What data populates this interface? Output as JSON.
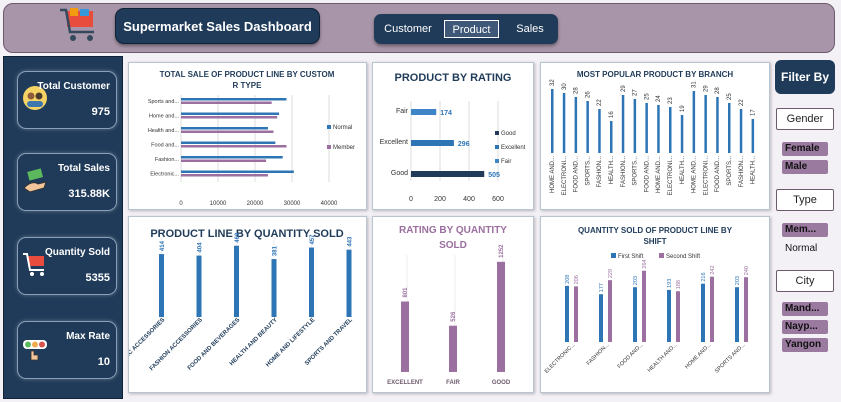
{
  "header": {
    "title": "Supermarket Sales Dashboard",
    "tabs": [
      {
        "label": "Customer",
        "active": false
      },
      {
        "label": "Product",
        "active": true
      },
      {
        "label": "Sales",
        "active": false
      }
    ]
  },
  "kpis": [
    {
      "label": "Total Customer",
      "value": "975",
      "icon": "customers-icon"
    },
    {
      "label": "Total Sales",
      "value": "315.88K",
      "icon": "money-hand-icon"
    },
    {
      "label": "Quantity Sold",
      "value": "5355",
      "icon": "cart-icon"
    },
    {
      "label": "Max Rate",
      "value": "10",
      "icon": "rating-icon"
    }
  ],
  "filters": {
    "title": "Filter By",
    "groups": [
      {
        "label": "Gender",
        "options": [
          "Female",
          "Male"
        ]
      },
      {
        "label": "Type",
        "options": [
          "Mem...",
          "Normal"
        ]
      },
      {
        "label": "City",
        "options": [
          "Mand...",
          "Nayp...",
          "Yangon"
        ]
      }
    ]
  },
  "colors": {
    "normal": "#2e75b6",
    "member": "#9b6fa0",
    "dark_blue": "#1f3b59",
    "header": "#a995a9"
  },
  "chart_data": [
    {
      "type": "bar",
      "orientation": "horizontal",
      "title": "TOTAL SALE OF PRODUCT LINE BY CUSTOMER TYPE",
      "categories": [
        "Sports and...",
        "Home and...",
        "Health and...",
        "Food and...",
        "Fashion...",
        "Electronic..."
      ],
      "series": [
        {
          "name": "Normal",
          "values": [
            28500,
            26500,
            23500,
            25500,
            27500,
            30500
          ]
        },
        {
          "name": "Member",
          "values": [
            24500,
            26000,
            25000,
            28500,
            23000,
            23500
          ]
        }
      ],
      "xticks": [
        "0",
        "10000",
        "20000",
        "30000",
        "40000"
      ],
      "xlim": [
        0,
        40000
      ],
      "legend": "right"
    },
    {
      "type": "bar",
      "orientation": "horizontal",
      "title": "PRODUCT BY RATING",
      "categories": [
        "Fair",
        "Excellent",
        "Good"
      ],
      "values": [
        174,
        296,
        505
      ],
      "xticks": [
        "0",
        "200",
        "400",
        "600"
      ],
      "xlim": [
        0,
        600
      ],
      "legend": [
        "Good",
        "Excellent",
        "Fair"
      ]
    },
    {
      "type": "bar",
      "title": "MOST POPULAR PRODUCT BY BRANCH",
      "categories": [
        "HOME AND...",
        "ELECTRONI...",
        "FOOD AND...",
        "SPORTS...",
        "FASHION...",
        "HEALTH...",
        "FASHION...",
        "SPORTS...",
        "FOOD AND...",
        "HOME AND...",
        "ELECTRONI...",
        "HEALTH...",
        "HOME AND...",
        "ELECTRONI...",
        "FOOD AND...",
        "SPORTS...",
        "FASHION...",
        "HEALTH..."
      ],
      "values": [
        32,
        30,
        28,
        26,
        22,
        16,
        29,
        27,
        25,
        24,
        23,
        19,
        31,
        29,
        28,
        25,
        22,
        17
      ]
    },
    {
      "type": "bar",
      "title": "PRODUCT LINE BY QUANTITY SOLD",
      "categories": [
        "ELECTRONIC ACCESSORIES",
        "FASHION ACCESSORIES",
        "FOOD AND BEVERAGES",
        "HEALTH AND BEAUTY",
        "HOME AND LIFESTYLE",
        "SPORTS AND TRAVEL"
      ],
      "values": [
        414,
        404,
        469,
        381,
        457,
        443
      ]
    },
    {
      "type": "bar",
      "title": "RATING BY QUANTITY SOLD",
      "categories": [
        "EXCELLENT",
        "FAIR",
        "GOOD"
      ],
      "values": [
        801,
        526,
        1252
      ]
    },
    {
      "type": "bar",
      "title": "QUANTITY SOLD OF PRODUCT LINE BY SHIFT",
      "categories": [
        "ELECTRONIC...",
        "FASHION...",
        "FOOD AND...",
        "HEALTH AND...",
        "HOME AND...",
        "SPORTS AND..."
      ],
      "series": [
        {
          "name": "First Shift",
          "values": [
            208,
            177,
            203,
            193,
            216,
            203
          ]
        },
        {
          "name": "Second Shift",
          "values": [
            206,
            229,
            264,
            188,
            242,
            240
          ]
        }
      ],
      "legend": "top"
    }
  ]
}
